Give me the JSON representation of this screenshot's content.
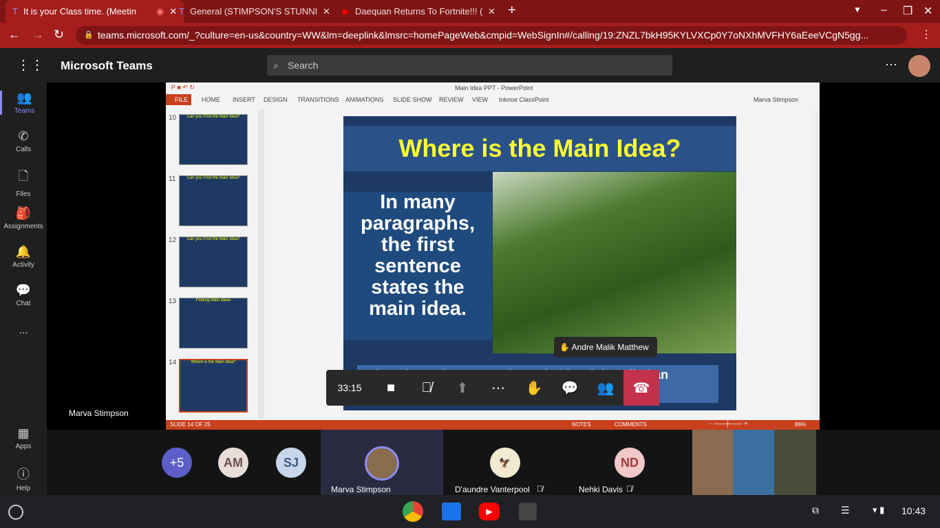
{
  "browser": {
    "tabs": [
      {
        "title": "It is your Class time. (Meetin",
        "active": true
      },
      {
        "title": "General (STIMPSON'S STUNNING",
        "active": false
      },
      {
        "title": "Daequan Returns To Fortnite!!! (",
        "active": false
      }
    ],
    "url": "teams.microsoft.com/_?culture=en-us&country=WW&lm=deeplink&lmsrc=homePageWeb&cmpid=WebSignIn#/calling/19:ZNZL7bkH95KYLVXCp0Y7oNXhMVFHY6aEeeVCgN5gg..."
  },
  "teams": {
    "app_title": "Microsoft Teams",
    "search_placeholder": "Search",
    "rail": [
      {
        "label": "Teams",
        "icon": "teams-icon"
      },
      {
        "label": "Calls",
        "icon": "phone-icon"
      },
      {
        "label": "Files",
        "icon": "file-icon"
      },
      {
        "label": "Assignments",
        "icon": "backpack-icon"
      },
      {
        "label": "Activity",
        "icon": "bell-icon"
      },
      {
        "label": "Chat",
        "icon": "chat-icon"
      },
      {
        "label": "...",
        "icon": "more-icon"
      },
      {
        "label": "Apps",
        "icon": "apps-icon"
      },
      {
        "label": "Help",
        "icon": "help-icon"
      }
    ],
    "presenter_name": "Marva Stimpson"
  },
  "ppt": {
    "window_title": "Main Idea PPT - PowerPoint",
    "user": "Marva Stimpson",
    "menu": [
      "FILE",
      "HOME",
      "INSERT",
      "DESIGN",
      "TRANSITIONS",
      "ANIMATIONS",
      "SLIDE SHOW",
      "REVIEW",
      "VIEW",
      "Inknoe ClassPoint"
    ],
    "thumbs": [
      {
        "num": "10",
        "title": "Can you Find the Main Idea?"
      },
      {
        "num": "11",
        "title": "Can you Find the Main Idea?"
      },
      {
        "num": "12",
        "title": "Can you Find the Main Idea?"
      },
      {
        "num": "13",
        "title": "Finding Main Ideas"
      },
      {
        "num": "14",
        "title": "Where is the Main Idea?"
      }
    ],
    "slide": {
      "title": "Where is the Main Idea?",
      "body": "In many paragraphs, the first sentence states the main idea.",
      "footer": "When the author states the main idea, it is called an explicit main idea."
    },
    "status": {
      "slide": "SLIDE 14 OF 25",
      "notes": "NOTES",
      "comments": "COMMENTS",
      "zoom": "86%"
    }
  },
  "call": {
    "timer": "33:15",
    "raised_hand": "Andre Malik Matthew",
    "participants": [
      {
        "initials": "+5",
        "color": "#5b5fc7"
      },
      {
        "initials": "AM",
        "color": "#e8ddd8"
      },
      {
        "initials": "SJ",
        "color": "#c7d6ea"
      }
    ],
    "tiles": [
      {
        "name": "Marva Stimpson"
      },
      {
        "name": "D'aundre Vanterpool",
        "muted": true
      },
      {
        "name": "Nehki Davis",
        "initials": "ND",
        "muted": true
      }
    ]
  },
  "taskbar": {
    "time": "10:43"
  }
}
